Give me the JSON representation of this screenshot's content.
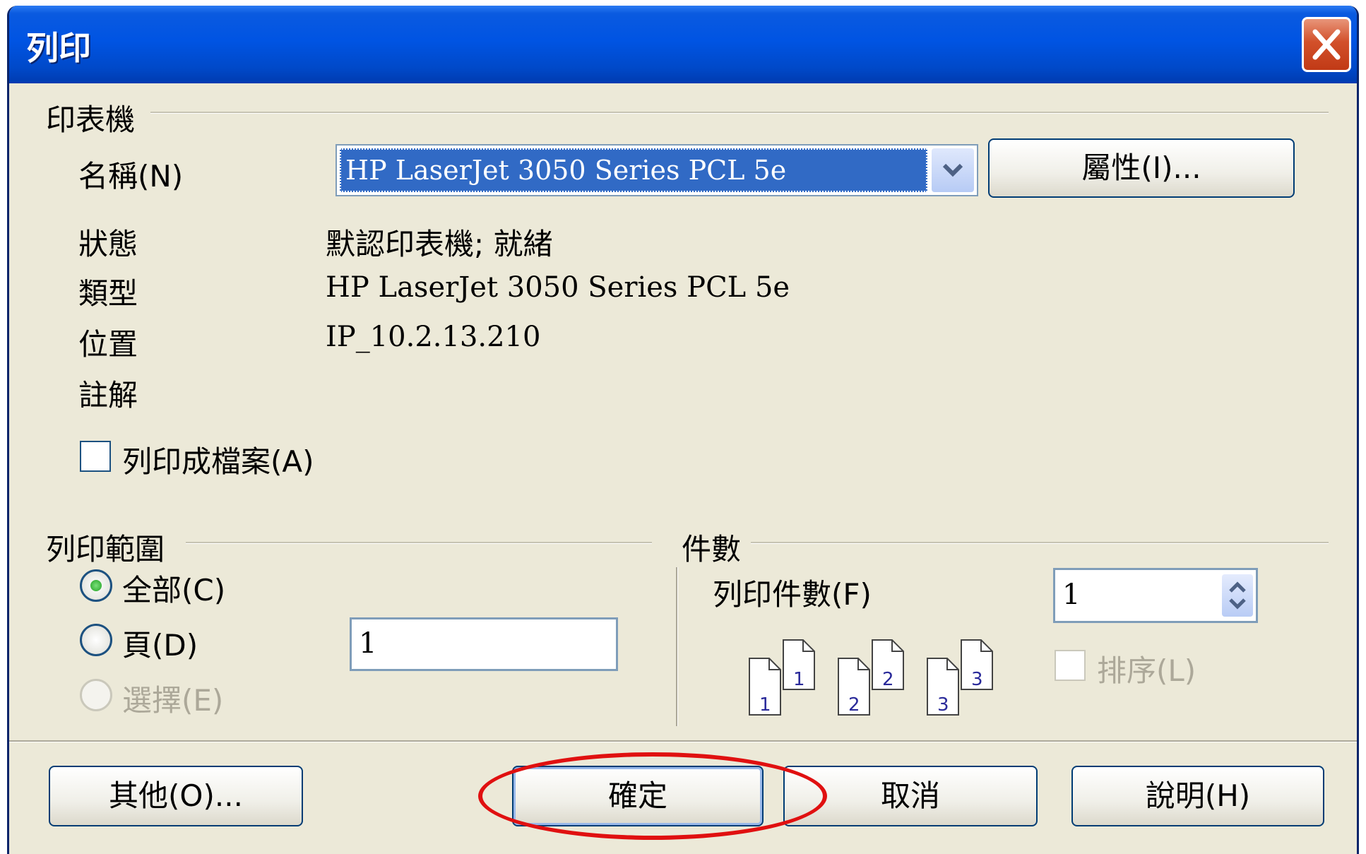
{
  "window": {
    "title": "列印"
  },
  "printer": {
    "group_title": "印表機",
    "name_label": "名稱(N)",
    "name_value": "HP LaserJet 3050 Series PCL 5e",
    "properties_button": "屬性(I)...",
    "status_label": "狀態",
    "status_value": "默認印表機; 就緒",
    "type_label": "類型",
    "type_value": "HP LaserJet 3050 Series PCL 5e",
    "location_label": "位置",
    "location_value": "IP_10.2.13.210",
    "comment_label": "註解",
    "print_to_file_label": "列印成檔案(A)",
    "print_to_file_checked": false
  },
  "print_range": {
    "group_title": "列印範圍",
    "all_label": "全部(C)",
    "pages_label": "頁(D)",
    "pages_value": "1",
    "selection_label": "選擇(E)",
    "selected": "all"
  },
  "copies": {
    "group_title": "件數",
    "count_label": "列印件數(F)",
    "count_value": "1",
    "collate_label": "排序(L)",
    "collate_checked": false,
    "page_icons": [
      "1",
      "1",
      "2",
      "2",
      "3",
      "3"
    ]
  },
  "buttons": {
    "other": "其他(O)...",
    "ok": "確定",
    "cancel": "取消",
    "help": "說明(H)"
  },
  "colors": {
    "titlebar": "#0054e3",
    "dialog_bg": "#ece9d8",
    "selection": "#316ac5",
    "highlight_ellipse": "#e01010"
  }
}
